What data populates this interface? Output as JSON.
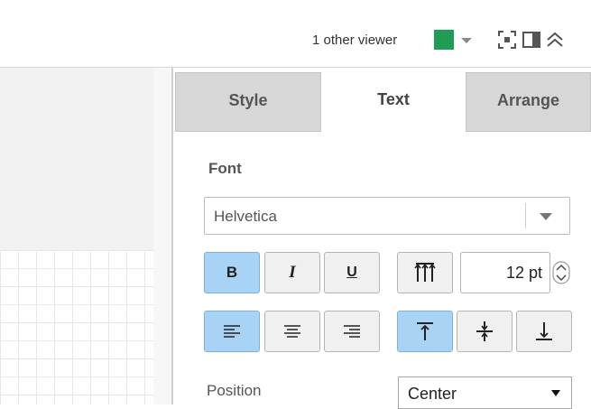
{
  "toolbar": {
    "viewer_count_text": "1 other viewer",
    "viewer_color": "#1e9e55",
    "icons": [
      "viewer-dropdown-icon",
      "fullscreen-icon",
      "format-panel-icon",
      "collapse-icon"
    ]
  },
  "panel": {
    "tabs": [
      {
        "label": "Style",
        "active": false
      },
      {
        "label": "Text",
        "active": true
      },
      {
        "label": "Arrange",
        "active": false
      }
    ],
    "font_section_label": "Font",
    "font_family": "Helvetica",
    "font_size": "12 pt",
    "style_buttons": {
      "bold": {
        "label": "B",
        "active": true
      },
      "italic": {
        "label": "I",
        "active": false
      },
      "underline": {
        "label": "U",
        "active": false
      }
    },
    "vertical_text_active": false,
    "align_active": "left",
    "valign_active": "top",
    "position_label": "Position",
    "position_value": "Center"
  },
  "colors": {
    "active_button": "#a9d3f5",
    "inactive_tab": "#d7d7d7"
  }
}
